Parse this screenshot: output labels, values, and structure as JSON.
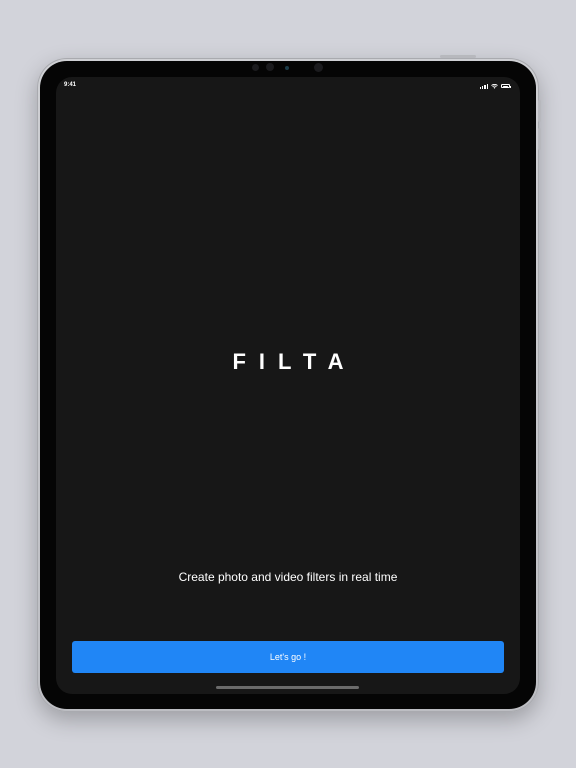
{
  "status_bar": {
    "time": "9:41"
  },
  "app": {
    "logo_text": "FILTA",
    "tagline": "Create photo and video filters in real time",
    "cta_label": "Let's go !"
  },
  "colors": {
    "screen_background": "#171717",
    "accent": "#2086f6",
    "text": "#ffffff",
    "page_background": "#d2d3da"
  },
  "icons": {
    "signal": "cellular-signal-icon",
    "wifi": "wifi-icon",
    "battery": "battery-icon"
  }
}
